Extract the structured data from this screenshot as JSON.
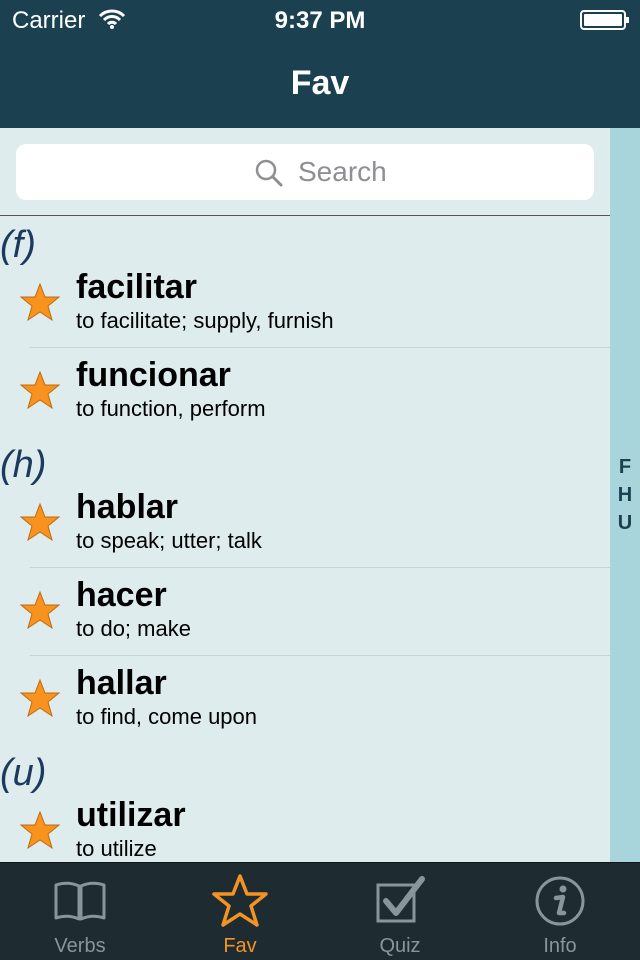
{
  "status_bar": {
    "carrier": "Carrier",
    "time": "9:37 PM"
  },
  "nav": {
    "title": "Fav"
  },
  "search": {
    "placeholder": "Search"
  },
  "sections": [
    {
      "header": "(f)",
      "rows": [
        {
          "verb": "facilitar",
          "meaning": "to facilitate; supply, furnish"
        },
        {
          "verb": "funcionar",
          "meaning": "to function, perform"
        }
      ]
    },
    {
      "header": "(h)",
      "rows": [
        {
          "verb": "hablar",
          "meaning": "to speak; utter; talk"
        },
        {
          "verb": "hacer",
          "meaning": "to do; make"
        },
        {
          "verb": "hallar",
          "meaning": "to find, come upon"
        }
      ]
    },
    {
      "header": "(u)",
      "rows": [
        {
          "verb": "utilizar",
          "meaning": "to utilize"
        }
      ]
    }
  ],
  "index": [
    "F",
    "H",
    "U"
  ],
  "tabs": [
    {
      "label": "Verbs",
      "icon": "book-icon",
      "active": false
    },
    {
      "label": "Fav",
      "icon": "star-icon",
      "active": true
    },
    {
      "label": "Quiz",
      "icon": "checkbox-icon",
      "active": false
    },
    {
      "label": "Info",
      "icon": "info-icon",
      "active": false
    }
  ],
  "colors": {
    "nav": "#1b4150",
    "accent": "#f39323",
    "star": "#f7931e",
    "background": "#dfecee",
    "index_bar": "#a8d4dc",
    "tab_bar": "#1e2b30"
  }
}
